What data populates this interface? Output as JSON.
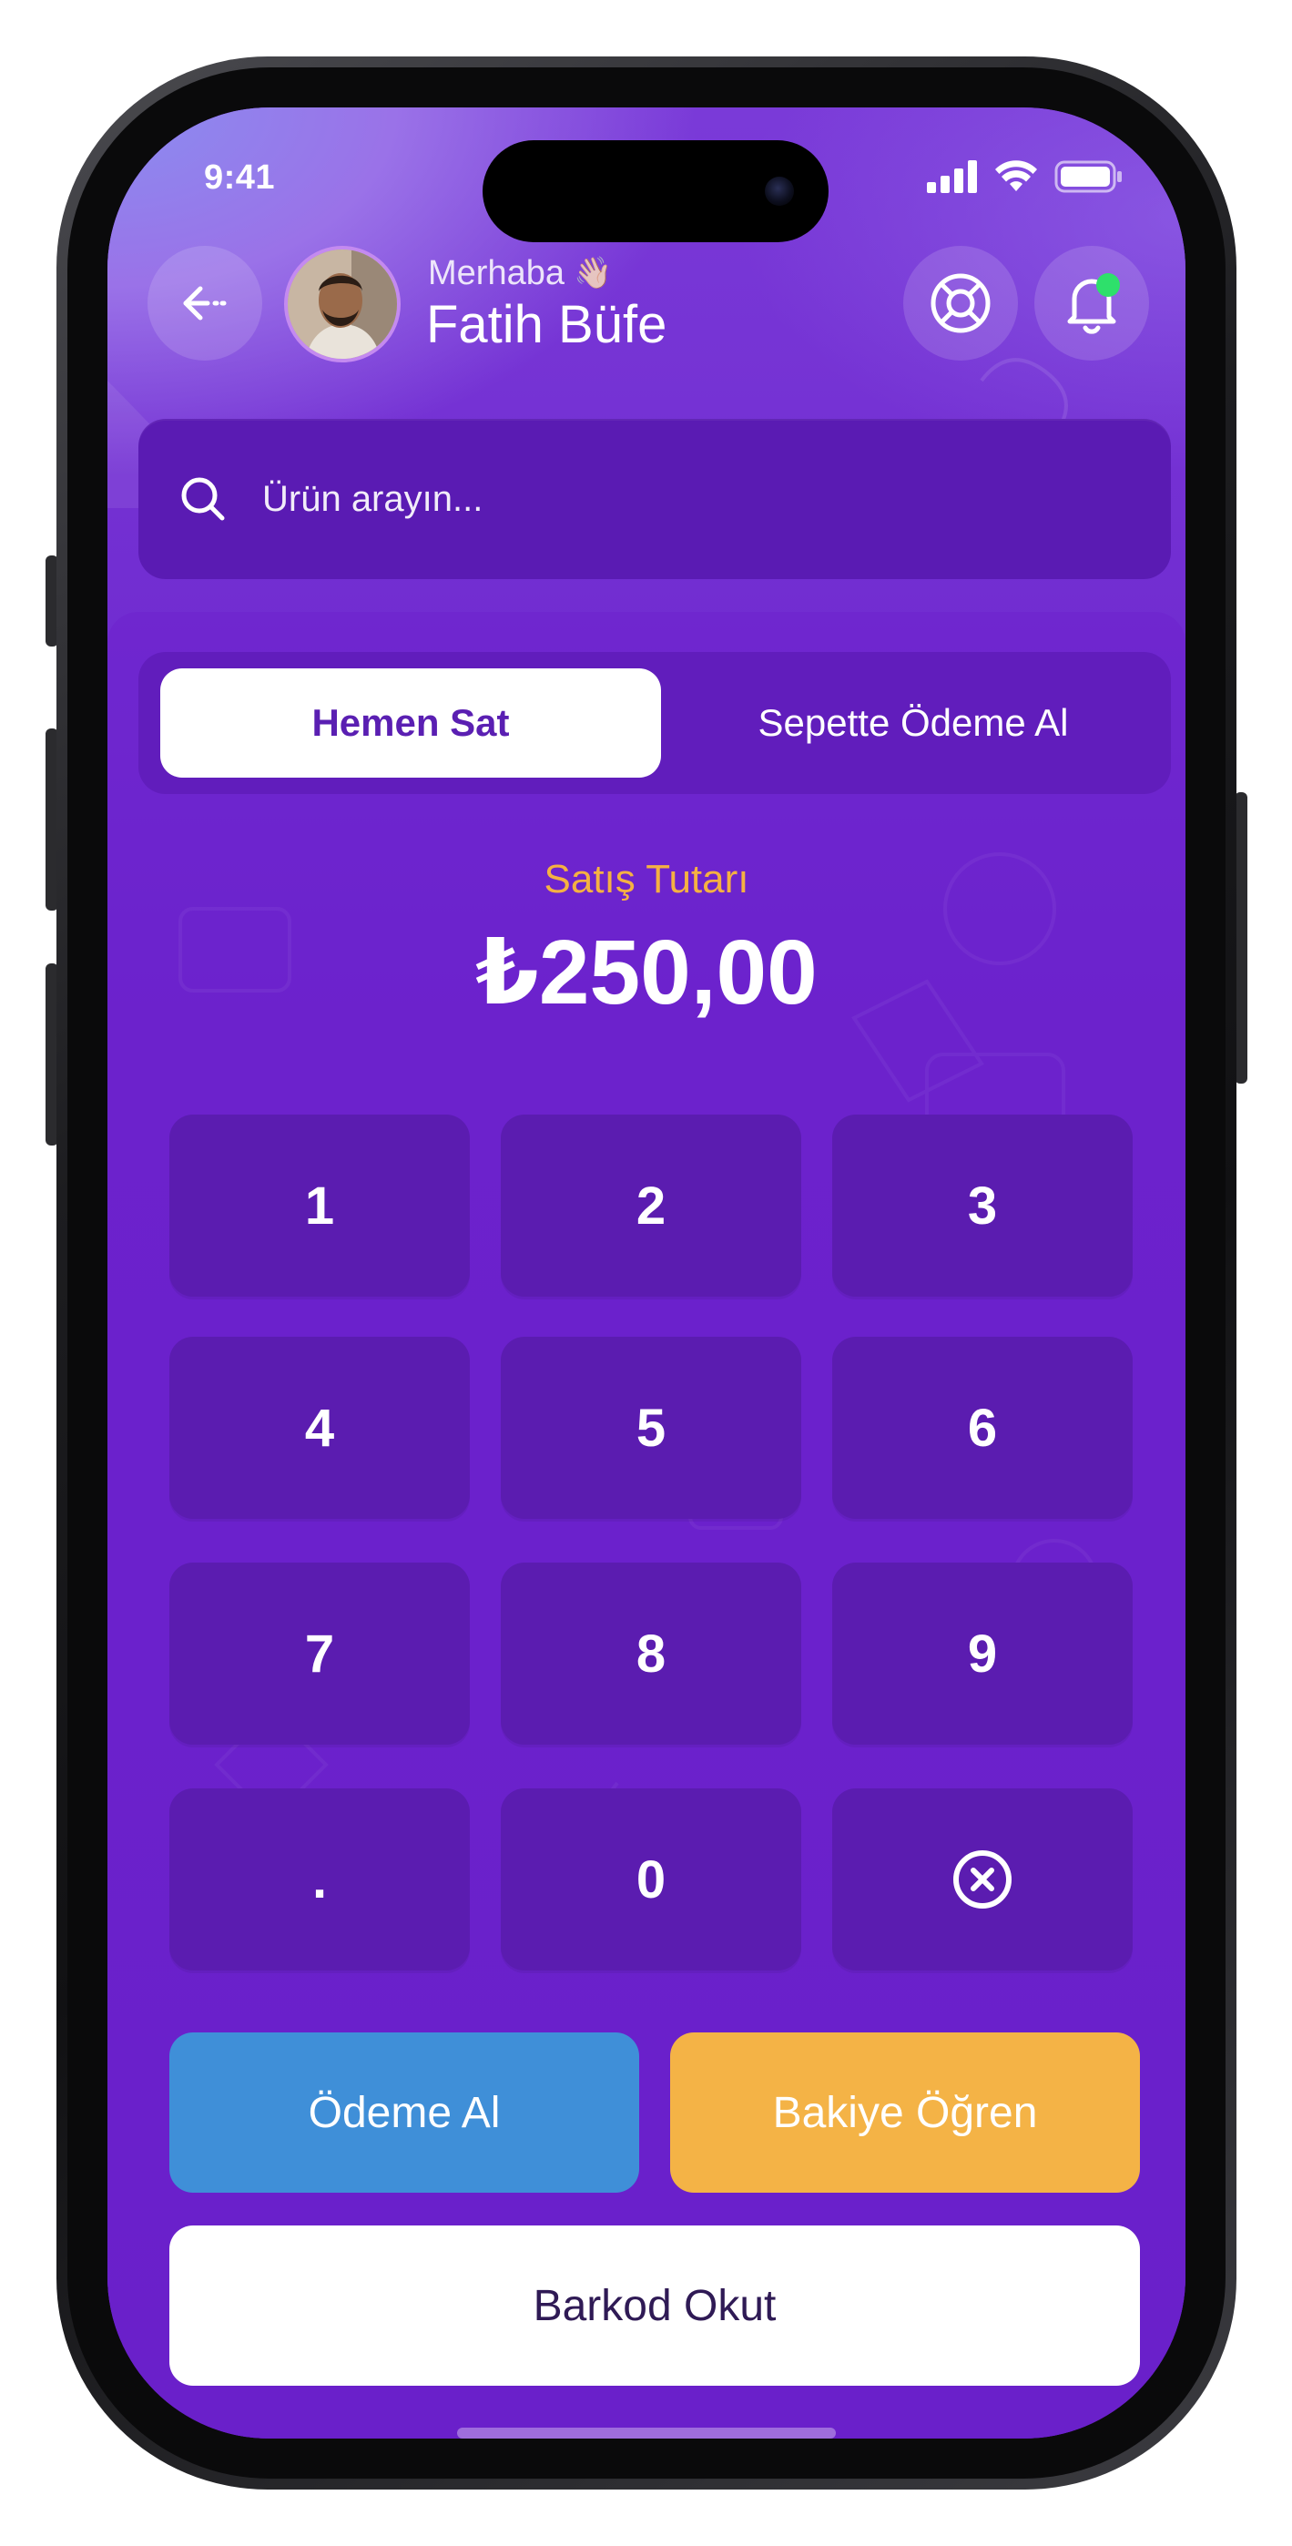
{
  "status_bar": {
    "time": "9:41"
  },
  "header": {
    "greeting": "Merhaba",
    "greeting_emoji": "👋🏻",
    "user_name": "Fatih Büfe",
    "icons": [
      "back-arrow-icon",
      "support-lifebuoy-icon",
      "notification-bell-icon"
    ],
    "notification_dot_color": "#2ee06b"
  },
  "search": {
    "placeholder": "Ürün arayın..."
  },
  "tabs": [
    {
      "label": "Hemen Sat",
      "active": true
    },
    {
      "label": "Sepette Ödeme Al",
      "active": false
    }
  ],
  "amount": {
    "label": "Satış Tutarı",
    "value": "₺250,00"
  },
  "keypad": {
    "keys": [
      "1",
      "2",
      "3",
      "4",
      "5",
      "6",
      "7",
      "8",
      "9",
      ".",
      "0"
    ],
    "delete_icon": "clear-circle-x-icon"
  },
  "actions": {
    "pay": "Ödeme Al",
    "balance": "Bakiye Öğren",
    "barcode": "Barkod Okut"
  },
  "colors": {
    "primary_purple": "#6a22cb",
    "accent_orange": "#f4b346",
    "accent_blue": "#3f8fd8",
    "amount_label": "#f5b142"
  }
}
